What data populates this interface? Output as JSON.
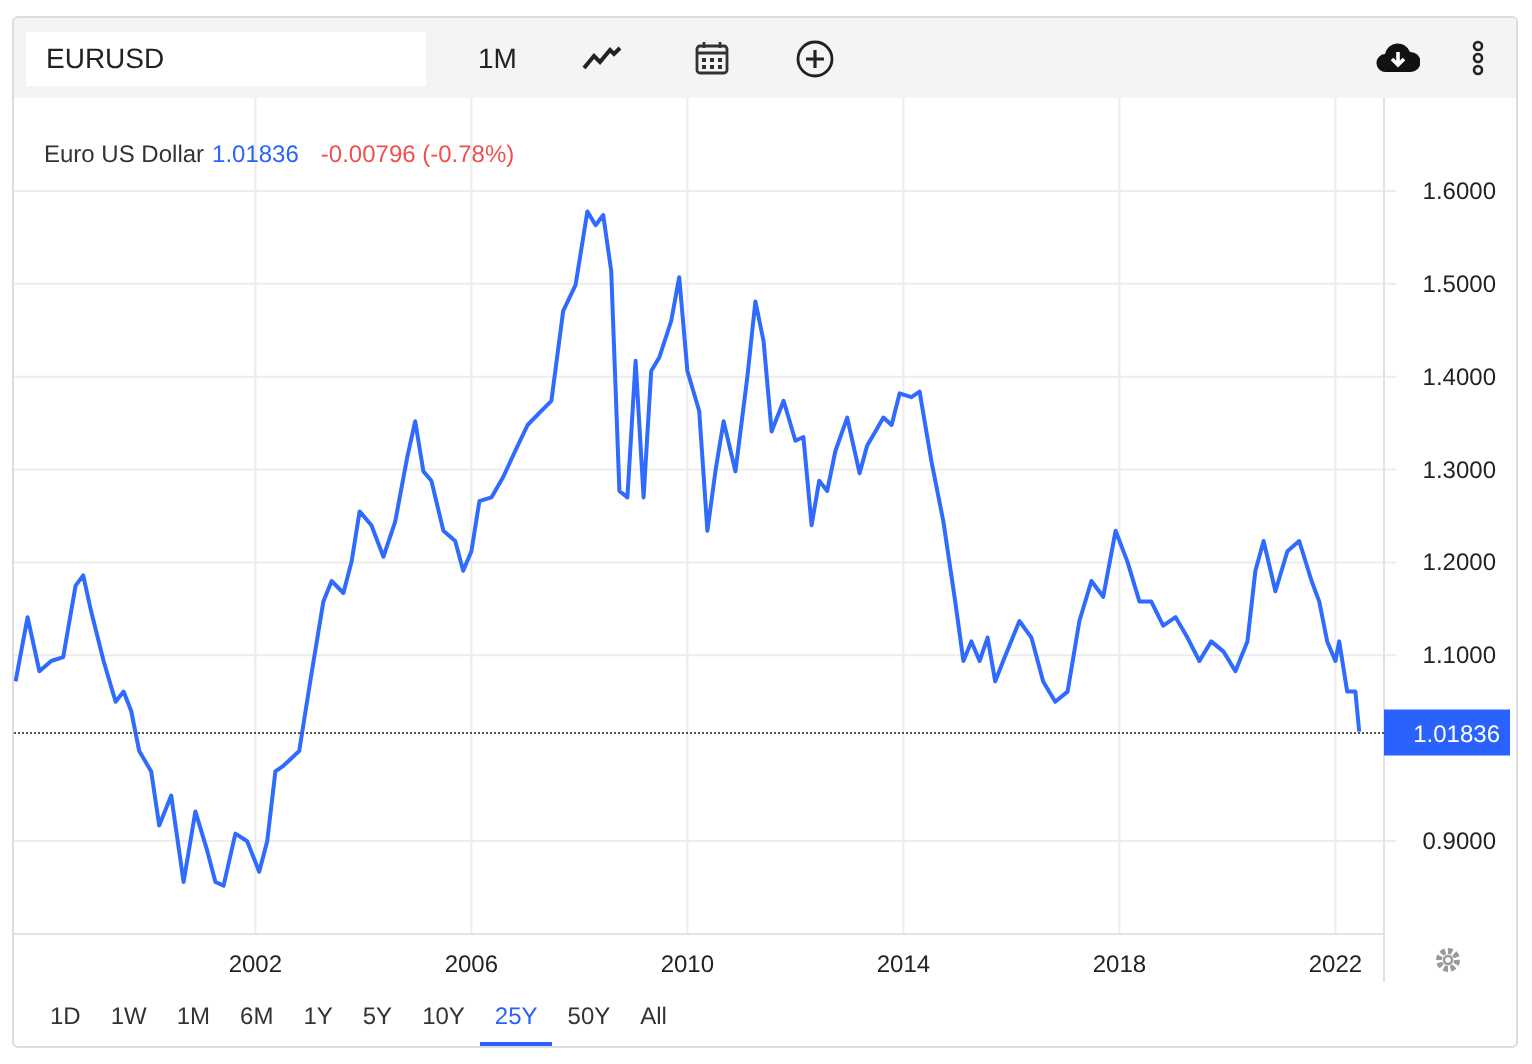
{
  "toolbar": {
    "symbol": "EURUSD",
    "interval": "1M"
  },
  "header": {
    "price": "1.01836",
    "change": "-0.00796 (-0.78%)"
  },
  "price_badge": "1.01836",
  "chart_data": {
    "type": "line",
    "grid": true,
    "xlim": [
      1997.53,
      2022.9
    ],
    "ylim": [
      0.8,
      1.7
    ],
    "xticks": [
      2002,
      2006,
      2010,
      2014,
      2018,
      2022
    ],
    "yticks": [
      {
        "value": 0.9,
        "label": "0.9000"
      },
      {
        "value": 1.1,
        "label": "1.1000"
      },
      {
        "value": 1.2,
        "label": "1.2000"
      },
      {
        "value": 1.3,
        "label": "1.3000"
      },
      {
        "value": 1.4,
        "label": "1.4000"
      },
      {
        "value": 1.5,
        "label": "1.5000"
      },
      {
        "value": 1.6,
        "label": "1.6000"
      }
    ],
    "x": [
      1997.56,
      1997.78,
      1998.0,
      1998.22,
      1998.44,
      1998.67,
      1998.81,
      1998.96,
      1999.19,
      1999.41,
      1999.56,
      1999.7,
      1999.85,
      2000.07,
      2000.22,
      2000.44,
      2000.67,
      2000.89,
      2001.11,
      2001.26,
      2001.41,
      2001.63,
      2001.85,
      2002.07,
      2002.22,
      2002.37,
      2002.52,
      2002.81,
      2003.04,
      2003.26,
      2003.41,
      2003.63,
      2003.78,
      2003.93,
      2004.15,
      2004.37,
      2004.59,
      2004.81,
      2004.96,
      2005.11,
      2005.26,
      2005.48,
      2005.7,
      2005.85,
      2006.0,
      2006.15,
      2006.37,
      2006.59,
      2006.81,
      2007.04,
      2007.26,
      2007.48,
      2007.7,
      2007.93,
      2008.15,
      2008.3,
      2008.44,
      2008.59,
      2008.74,
      2008.89,
      2009.04,
      2009.19,
      2009.33,
      2009.48,
      2009.7,
      2009.85,
      2010.0,
      2010.22,
      2010.37,
      2010.52,
      2010.67,
      2010.89,
      2011.11,
      2011.26,
      2011.41,
      2011.56,
      2011.78,
      2012.0,
      2012.15,
      2012.3,
      2012.44,
      2012.59,
      2012.74,
      2012.96,
      2013.19,
      2013.33,
      2013.48,
      2013.63,
      2013.78,
      2013.93,
      2014.15,
      2014.3,
      2014.52,
      2014.74,
      2014.96,
      2015.11,
      2015.26,
      2015.41,
      2015.56,
      2015.7,
      2015.85,
      2016.15,
      2016.37,
      2016.59,
      2016.81,
      2017.04,
      2017.26,
      2017.48,
      2017.7,
      2017.93,
      2018.15,
      2018.37,
      2018.59,
      2018.81,
      2019.04,
      2019.26,
      2019.48,
      2019.7,
      2019.93,
      2020.15,
      2020.37,
      2020.52,
      2020.67,
      2020.89,
      2021.11,
      2021.33,
      2021.56,
      2021.7,
      2021.85,
      2022.0,
      2022.07,
      2022.22,
      2022.37,
      2022.44
    ],
    "series": [
      {
        "name": "Euro US Dollar",
        "color": "#2f6bff",
        "values": [
          1.072,
          1.141,
          1.083,
          1.094,
          1.098,
          1.175,
          1.186,
          1.147,
          1.094,
          1.05,
          1.061,
          1.04,
          0.997,
          0.975,
          0.917,
          0.949,
          0.856,
          0.932,
          0.889,
          0.856,
          0.852,
          0.908,
          0.9,
          0.867,
          0.9,
          0.975,
          0.981,
          0.997,
          1.081,
          1.158,
          1.18,
          1.167,
          1.201,
          1.255,
          1.24,
          1.206,
          1.244,
          1.313,
          1.352,
          1.298,
          1.288,
          1.234,
          1.223,
          1.191,
          1.212,
          1.266,
          1.27,
          1.292,
          1.32,
          1.348,
          1.361,
          1.374,
          1.471,
          1.499,
          1.578,
          1.563,
          1.574,
          1.514,
          1.277,
          1.27,
          1.417,
          1.27,
          1.406,
          1.421,
          1.46,
          1.507,
          1.406,
          1.363,
          1.234,
          1.298,
          1.352,
          1.298,
          1.4,
          1.481,
          1.438,
          1.341,
          1.374,
          1.331,
          1.335,
          1.24,
          1.288,
          1.277,
          1.32,
          1.356,
          1.296,
          1.326,
          1.341,
          1.356,
          1.348,
          1.382,
          1.378,
          1.384,
          1.309,
          1.244,
          1.158,
          1.094,
          1.115,
          1.094,
          1.119,
          1.072,
          1.094,
          1.137,
          1.119,
          1.072,
          1.05,
          1.061,
          1.137,
          1.18,
          1.163,
          1.234,
          1.201,
          1.158,
          1.158,
          1.132,
          1.141,
          1.119,
          1.094,
          1.115,
          1.104,
          1.083,
          1.115,
          1.191,
          1.223,
          1.169,
          1.212,
          1.223,
          1.18,
          1.158,
          1.115,
          1.094,
          1.115,
          1.061,
          1.061,
          1.018
        ]
      }
    ]
  },
  "ranges": [
    {
      "label": "1D",
      "selected": false
    },
    {
      "label": "1W",
      "selected": false
    },
    {
      "label": "1M",
      "selected": false
    },
    {
      "label": "6M",
      "selected": false
    },
    {
      "label": "1Y",
      "selected": false
    },
    {
      "label": "5Y",
      "selected": false
    },
    {
      "label": "10Y",
      "selected": false
    },
    {
      "label": "25Y",
      "selected": true
    },
    {
      "label": "50Y",
      "selected": false
    },
    {
      "label": "All",
      "selected": false
    }
  ]
}
